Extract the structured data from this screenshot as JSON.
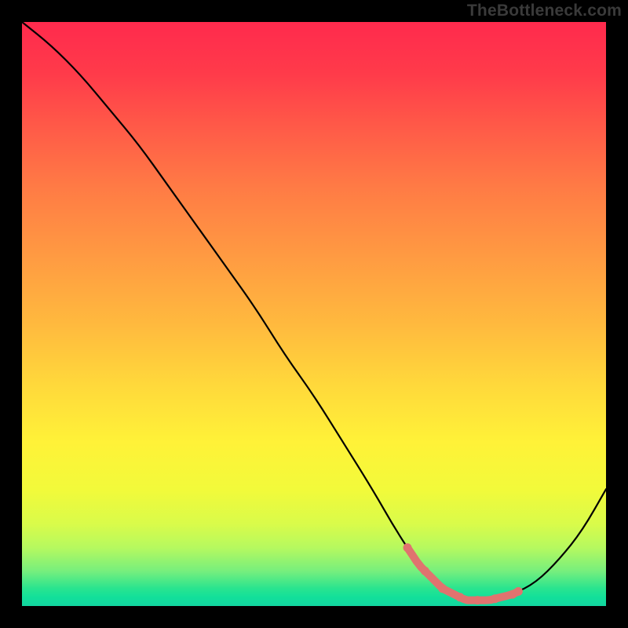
{
  "watermark": "TheBottleneck.com",
  "chart_data": {
    "type": "line",
    "title": "",
    "xlabel": "",
    "ylabel": "",
    "xlim": [
      0,
      100
    ],
    "ylim": [
      0,
      100
    ],
    "grid": false,
    "legend": false,
    "background_gradient": [
      "#ff2a4d",
      "#ffba3e",
      "#fff238",
      "#12d6a0"
    ],
    "series": [
      {
        "name": "bottleneck-curve",
        "x": [
          0,
          5,
          10,
          15,
          20,
          25,
          30,
          35,
          40,
          45,
          50,
          55,
          60,
          64,
          68,
          72,
          76,
          80,
          84,
          88,
          92,
          96,
          100
        ],
        "y": [
          100,
          96,
          91,
          85,
          79,
          72,
          65,
          58,
          51,
          43,
          36,
          28,
          20,
          13,
          7,
          3,
          1,
          1,
          2,
          4,
          8,
          13,
          20
        ]
      }
    ],
    "annotations": {
      "optimal_range_x": [
        66,
        85
      ],
      "dots_x": [
        66,
        69,
        72,
        75,
        78,
        81,
        84,
        85
      ]
    }
  }
}
